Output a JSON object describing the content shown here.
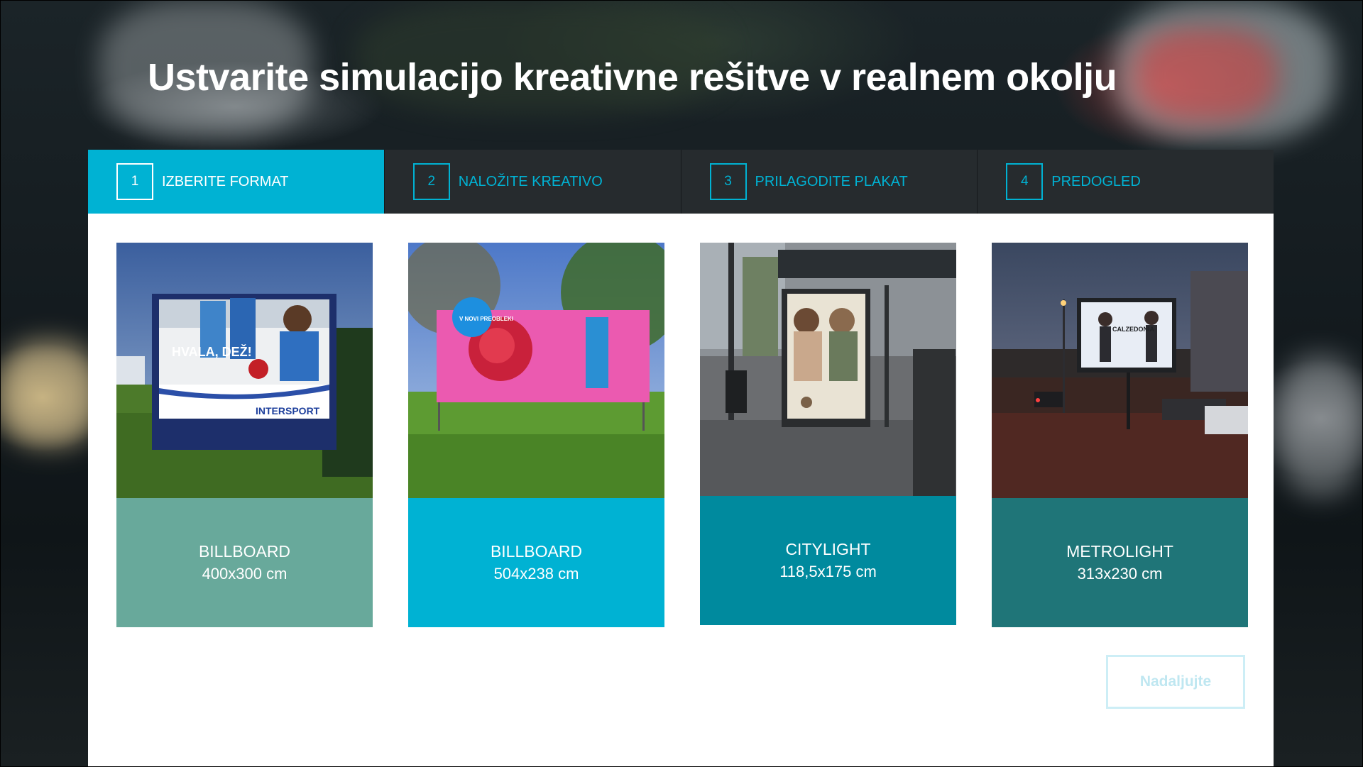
{
  "page_title": "Ustvarite simulacijo kreativne rešitve v realnem okolju",
  "steps": [
    {
      "number": "1",
      "label": "IZBERITE FORMAT",
      "active": true
    },
    {
      "number": "2",
      "label": "NALOŽITE KREATIVO",
      "active": false
    },
    {
      "number": "3",
      "label": "PRILAGODITE PLAKAT",
      "active": false
    },
    {
      "number": "4",
      "label": "PREDOGLED",
      "active": false
    }
  ],
  "formats": [
    {
      "name": "BILLBOARD",
      "size": "400x300 cm",
      "color": "#68a99b",
      "poster_text": "HVALA, DEŽ!",
      "poster_brand": "INTERSPORT"
    },
    {
      "name": "BILLBOARD",
      "size": "504x238 cm",
      "color": "#00b2d3",
      "poster_badge": "V NOVI PREOBLEKI"
    },
    {
      "name": "CITYLIGHT",
      "size": "118,5x175 cm",
      "color": "#008a9e"
    },
    {
      "name": "METROLIGHT",
      "size": "313x230 cm",
      "color": "#1f7578",
      "poster_text": "CALZEDONIA"
    }
  ],
  "next_button_label": "Nadaljujte",
  "colors": {
    "accent": "#00b2d3",
    "steps_bg": "#262b2e",
    "disabled_text": "#bfe7f1"
  }
}
